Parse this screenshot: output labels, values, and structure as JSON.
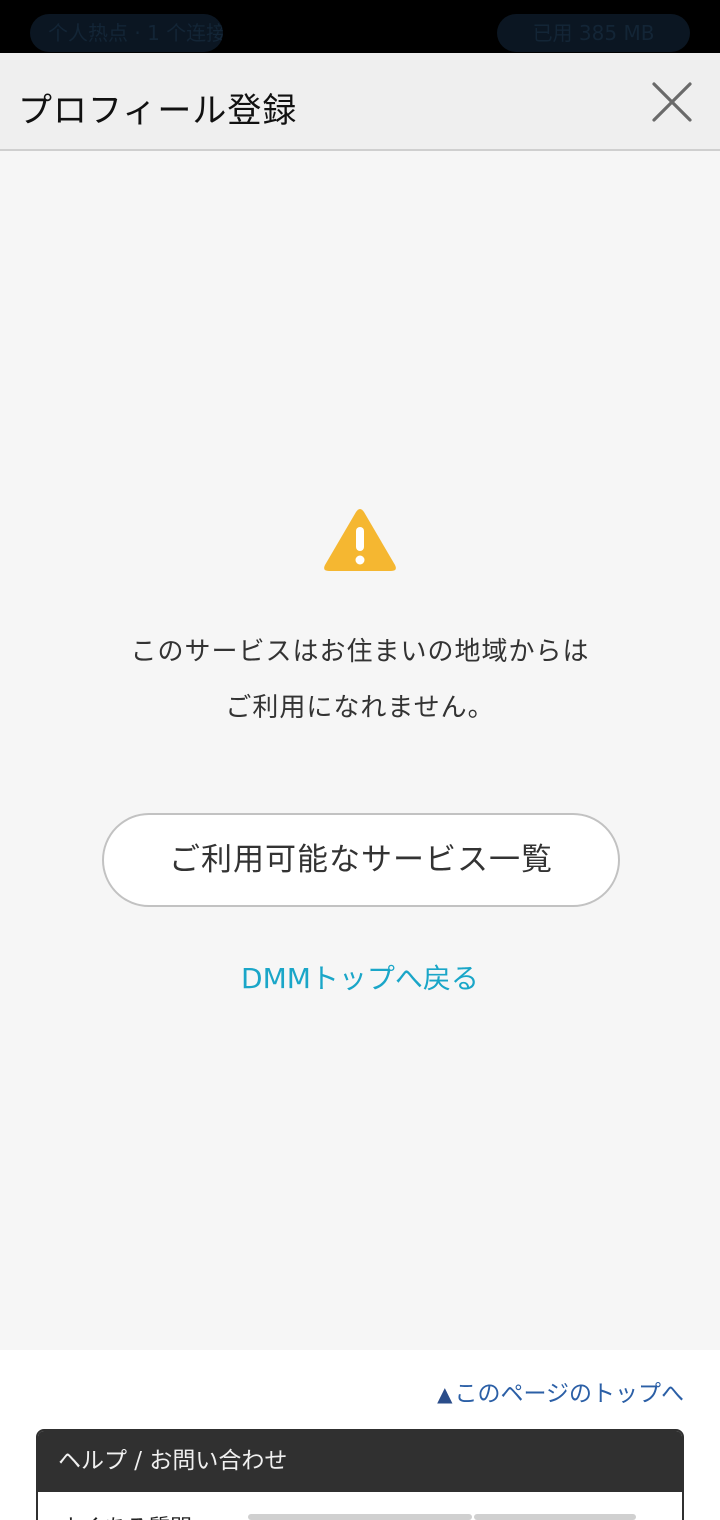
{
  "status_bar": {
    "left_pill": "个人热点 · 1 个连接",
    "right_pill": "已用 385 MB"
  },
  "header": {
    "title": "プロフィール登録",
    "close_icon": "close-icon"
  },
  "main": {
    "warning_icon": "warning-triangle-icon",
    "warning_color": "#f5b731",
    "message_line1": "このサービスはお住まいの地域からは",
    "message_line2": "ご利用になれません。",
    "services_button_label": "ご利用可能なサービス一覧",
    "back_link_label": "DMMトップへ戻る",
    "link_color": "#1aa6c8"
  },
  "footer": {
    "page_top_link": "このページのトップへ",
    "page_top_icon": "▲",
    "help_title": "ヘルプ / お問い合わせ",
    "help_first_item": "よくある質問"
  }
}
